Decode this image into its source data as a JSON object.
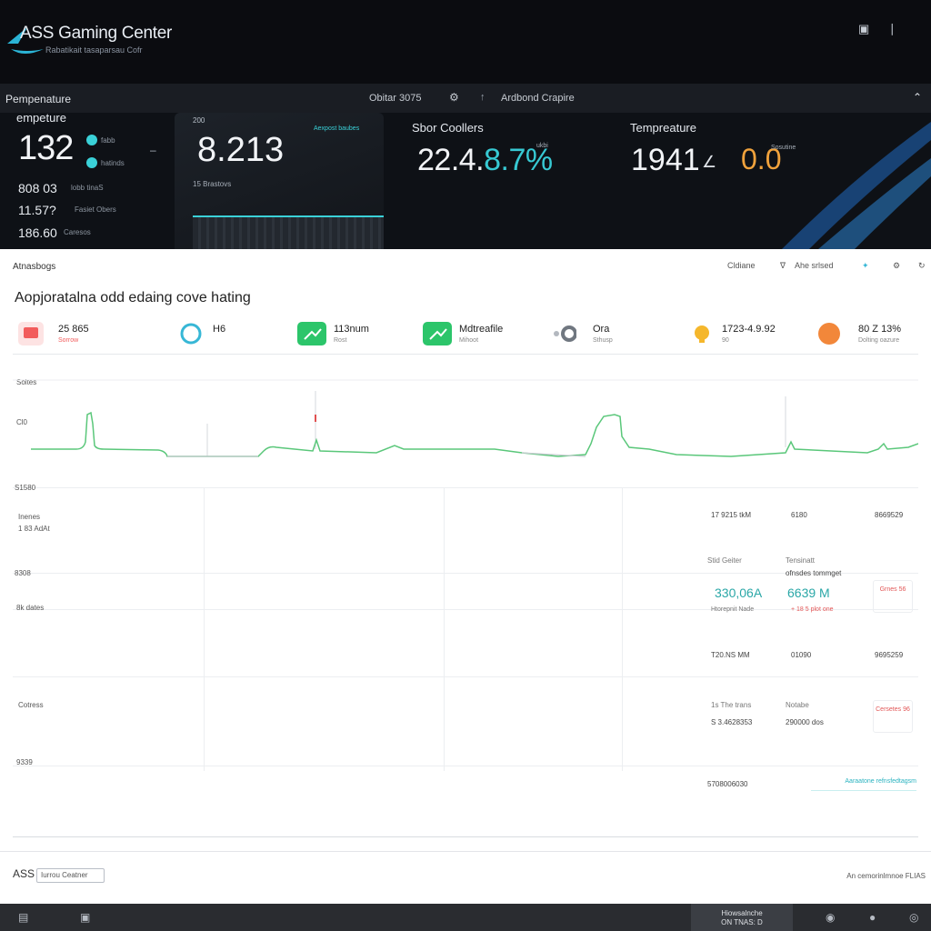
{
  "app": {
    "title": "ASS Gaming Center",
    "subtitle": "Rabatikait tasaparsau Cofr",
    "window_icons": [
      "monitor-icon",
      "more-icon"
    ]
  },
  "band": {
    "header_left": "Pempenature",
    "header_mid": "Obitar 3075",
    "header_right": "Ardbond Crapire",
    "panel1": {
      "label": "empeture",
      "big": "132",
      "legend": [
        "fabb",
        "hatinds"
      ],
      "rows": [
        {
          "value": "808 03",
          "label": "lobb tinaS"
        },
        {
          "value": "11.57?",
          "label": "Fasiet Obers"
        },
        {
          "value": "186.60",
          "label": "Caresos"
        }
      ]
    },
    "panel2": {
      "top": "200",
      "tag": "Aexpost baubes",
      "big": "8.213",
      "sub": "15 Brastovs"
    },
    "panel3": {
      "title": "Sbor Coollers",
      "big_a": "22.4.",
      "big_b": "8.7",
      "big_c": "%",
      "tag": "ukbi"
    },
    "panel4": {
      "title": "Tempreature",
      "big": "1941",
      "amber": "0.0",
      "tag": "Sosutine"
    }
  },
  "card": {
    "toolbar_left": "Atnasbogs",
    "toolbar_items": [
      "Cldiane",
      "Ahe srlsed"
    ],
    "title": "Aopjoratalna odd edaing cove hating",
    "stats": [
      {
        "icon": "flag-icon",
        "value": "25 865",
        "label": "Sorrow",
        "color": "#f25c5c"
      },
      {
        "icon": "globe-icon",
        "value": "H6",
        "label": "",
        "color": "#37b7d6"
      },
      {
        "icon": "trend-up-icon",
        "value": "113num",
        "label": "Rost",
        "color": "#2cc56a"
      },
      {
        "icon": "trend-up-icon",
        "value": "Mdtreafile",
        "label": "Mihoot",
        "color": "#2cc56a"
      },
      {
        "icon": "network-icon",
        "value": "Ora",
        "label": "Sthusp",
        "color": "#707780"
      },
      {
        "icon": "bulb-icon",
        "value": "1723-4.9.92",
        "label": "90",
        "color": "#f5b72c"
      },
      {
        "icon": "badge-icon",
        "value": "80 Z 13%",
        "label": "Dolting oazure",
        "color": "#f2873a"
      }
    ],
    "graph": {
      "y_top": "Soites",
      "y_mid": "Cl0"
    },
    "y_labels": [
      "S1580",
      "Inenes",
      "1 83 AdAt",
      "8308",
      "8k dates",
      "Cotress",
      "9339"
    ],
    "table": {
      "r1": [
        "17 9215 tkM",
        "6180",
        "8669529"
      ],
      "r2_hdr": [
        "Stid Geiter",
        "Tensinatt",
        "ofnsdes tommget"
      ],
      "r2_big": [
        "330,06A",
        "6639 M"
      ],
      "r2_small": [
        "Htorepnit Nade",
        "+ 18 5 plot one"
      ],
      "r2_box": "Grnes 56",
      "r3": [
        "T20.NS MM",
        "01090",
        "9695259"
      ],
      "r4_hdr": [
        "1s The trans",
        "Notabe"
      ],
      "r4_vals": [
        "S 3.4628353",
        "290000 dos"
      ],
      "r4_box": "Cersetes 96",
      "r5": "5708006030",
      "link": "Aaraatone refnsfedtagsm"
    }
  },
  "footer": {
    "brand": "ASS",
    "field": "Iurrou Ceatner",
    "right": "An cemorinlmnoe FLIAS"
  },
  "taskbar": {
    "clock_line1": "Hiowsalnche",
    "clock_line2": "ON TNAS: D",
    "icons": [
      "window-icon",
      "folder-icon",
      "game-icon",
      "controller-icon",
      "chrome-icon"
    ]
  },
  "colors": {
    "accent_teal": "#37c9d3",
    "accent_amber": "#f0a23c",
    "graph_line": "#5ac77a",
    "dark_bg": "#0e1116"
  }
}
